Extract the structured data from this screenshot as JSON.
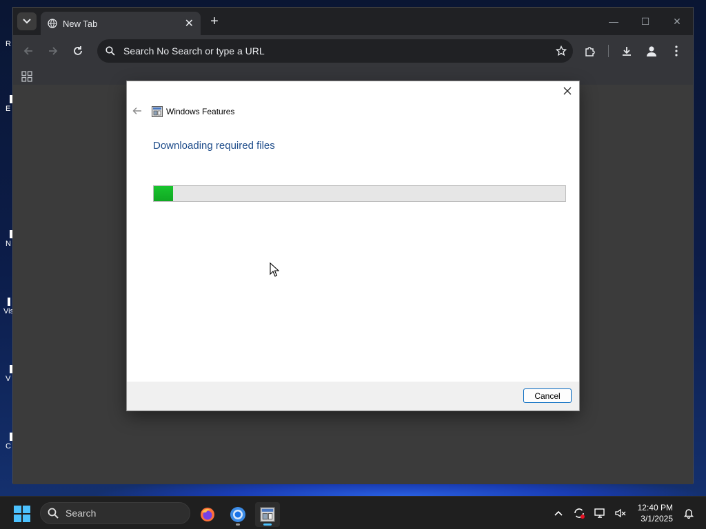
{
  "browser": {
    "tab_title": "New Tab",
    "omnibox_text": "Search No Search or type a URL"
  },
  "dialog": {
    "title": "Windows Features",
    "heading": "Downloading required files",
    "progress_fraction": 0.047,
    "cancel_label": "Cancel"
  },
  "desktop": {
    "icon_labels": [
      "R",
      "E",
      "N",
      "Vis",
      "V",
      "C"
    ]
  },
  "taskbar": {
    "search_label": "Search",
    "time": "12:40 PM",
    "date": "3/1/2025"
  },
  "colors": {
    "progress_green": "#19c42e",
    "heading_blue": "#1e4c8a",
    "accent": "#0067c0"
  }
}
